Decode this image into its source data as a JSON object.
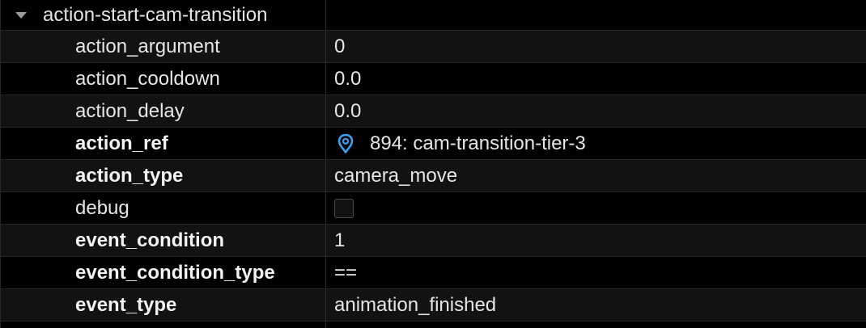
{
  "group": {
    "name": "action-start-cam-transition",
    "expanded": true
  },
  "properties": [
    {
      "key": "action_argument",
      "value": "0",
      "bold": false
    },
    {
      "key": "action_cooldown",
      "value": "0.0",
      "bold": false
    },
    {
      "key": "action_delay",
      "value": "0.0",
      "bold": false
    },
    {
      "key": "action_ref",
      "value": "894: cam-transition-tier-3",
      "bold": true,
      "icon": "location-pin-icon"
    },
    {
      "key": "action_type",
      "value": "camera_move",
      "bold": true
    },
    {
      "key": "debug",
      "value": "",
      "bold": false,
      "checkbox_checked": false
    },
    {
      "key": "event_condition",
      "value": "1",
      "bold": true
    },
    {
      "key": "event_condition_type",
      "value": "==",
      "bold": true
    },
    {
      "key": "event_type",
      "value": "animation_finished",
      "bold": true
    }
  ],
  "colors": {
    "background": "#000000",
    "alt_row": "#121212",
    "text": "#e6e6e6",
    "ref_icon": "#3aa0f0",
    "divider": "#262626"
  }
}
